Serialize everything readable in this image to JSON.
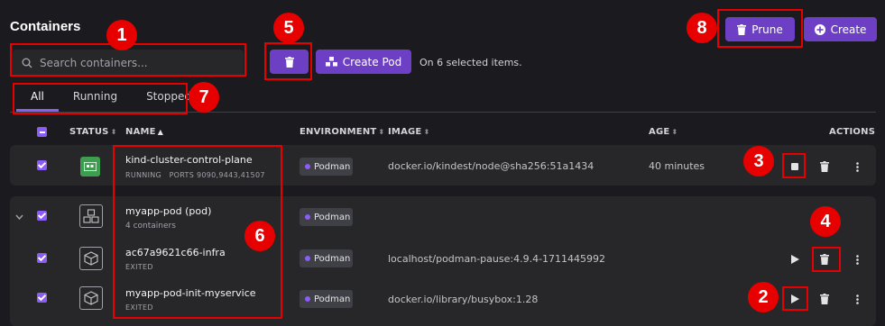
{
  "page": {
    "title": "Containers"
  },
  "search": {
    "placeholder": "Search containers..."
  },
  "toolbar": {
    "create_pod_label": "Create Pod",
    "selection_info": "On 6 selected items.",
    "prune_label": "Prune",
    "create_label": "Create"
  },
  "tabs": [
    "All",
    "Running",
    "Stopped"
  ],
  "columns": {
    "status": "STATUS",
    "name": "NAME",
    "environment": "ENVIRONMENT",
    "image": "IMAGE",
    "age": "AGE",
    "actions": "ACTIONS"
  },
  "rows": [
    {
      "name": "kind-cluster-control-plane",
      "state": "RUNNING",
      "ports": "PORTS 9090,9443,41507",
      "environment": "Podman",
      "image": "docker.io/kindest/node@sha256:51a1434",
      "age": "40 minutes"
    },
    {
      "name": "myapp-pod (pod)",
      "state": "4 containers",
      "environment": "Podman",
      "image": "",
      "age": ""
    },
    {
      "name": "ac67a9621c66-infra",
      "state": "EXITED",
      "environment": "Podman",
      "image": "localhost/podman-pause:4.9.4-1711445992",
      "age": ""
    },
    {
      "name": "myapp-pod-init-myservice",
      "state": "EXITED",
      "environment": "Podman",
      "image": "docker.io/library/busybox:1.28",
      "age": ""
    }
  ],
  "annotations": [
    "1",
    "2",
    "3",
    "4",
    "5",
    "6",
    "7",
    "8"
  ],
  "colors": {
    "accent": "#6d3fc4",
    "running": "#3e9e4f",
    "callout": "#e60000",
    "background": "#1b1b1f",
    "card": "#27272a"
  },
  "icons": {
    "search": "search-icon",
    "trash": "trash-icon",
    "pod": "pod-icon",
    "plus": "plus-circle-icon",
    "running": "running-container-icon",
    "container": "container-box-icon",
    "stop": "stop-icon",
    "play": "play-icon",
    "kebab": "kebab-menu-icon",
    "chevron": "chevron-down-icon"
  }
}
